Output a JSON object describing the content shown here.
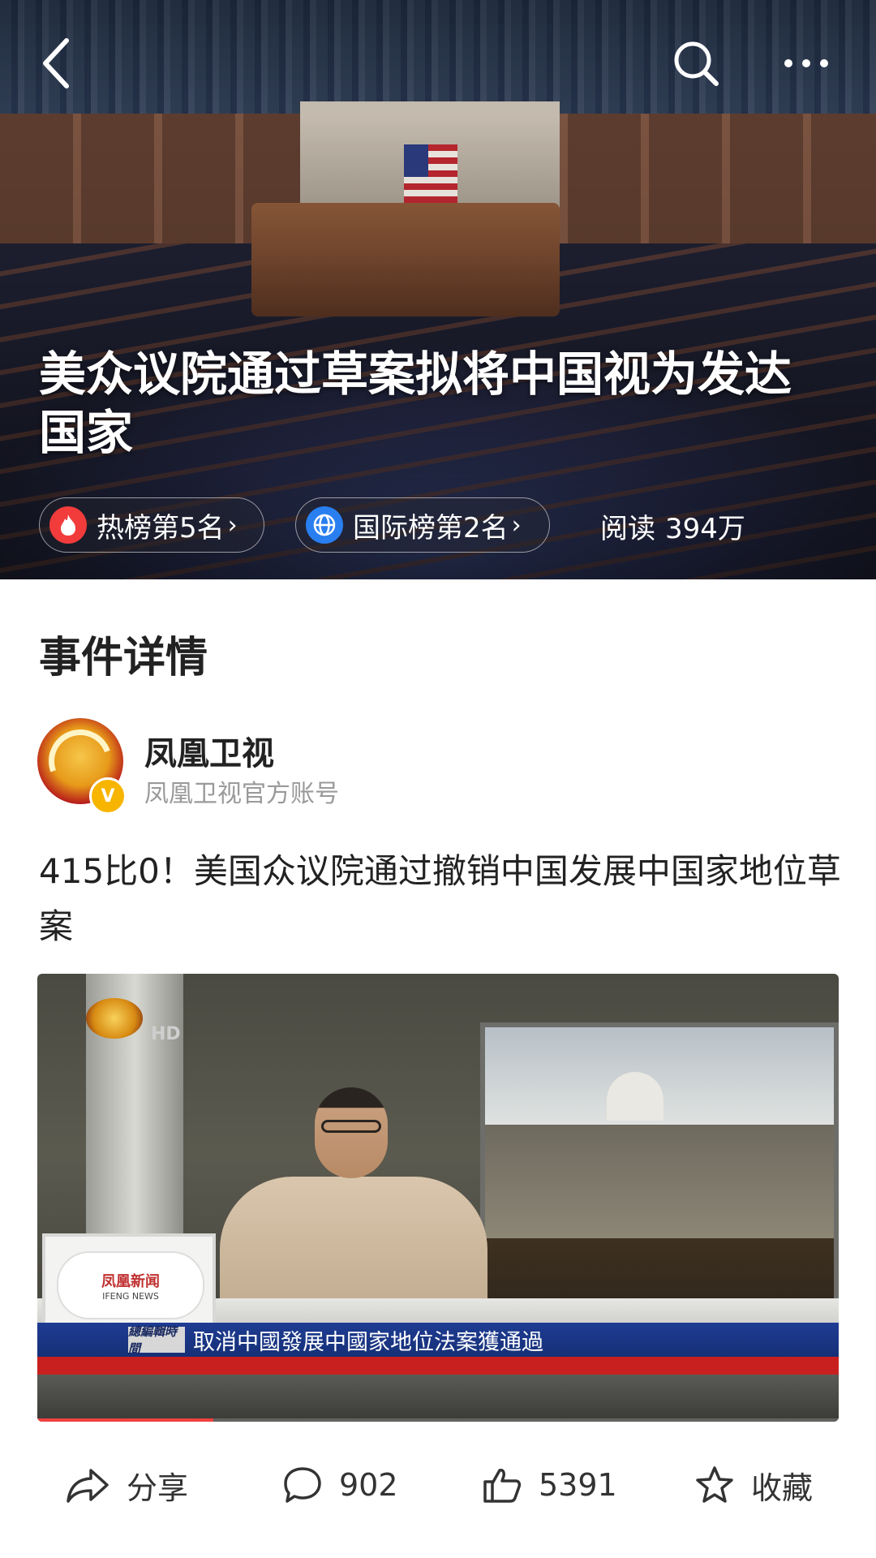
{
  "header": {
    "title": "美众议院通过草案拟将中国视为发达国家",
    "icons": {
      "back": "back-arrow-icon",
      "search": "search-icon",
      "more": "more-dots-icon"
    }
  },
  "badges": [
    {
      "label": "热榜第5名",
      "icon": "fire-icon",
      "color": "#f23c3c"
    },
    {
      "label": "国际榜第2名",
      "icon": "globe-icon",
      "color": "#2a7ff0"
    }
  ],
  "reads": {
    "label": "阅读",
    "count": "394万"
  },
  "section": {
    "title": "事件详情"
  },
  "account": {
    "name": "凤凰卫视",
    "description": "凤凰卫视官方账号"
  },
  "post": {
    "text": "415比0！美国众议院通过撤销中国发展中国家地位草案",
    "video": {
      "hd_label": "HD",
      "monitor_logo": "凤凰新闻",
      "monitor_logo_sub": "IFENG NEWS",
      "ticker_tag": "總編輯時間",
      "ticker_text": "取消中國發展中國家地位法案獲通過",
      "progress": 0.22
    }
  },
  "actions": {
    "share": {
      "label": "分享",
      "icon": "share-icon"
    },
    "comments": {
      "count": "902",
      "icon": "comment-icon"
    },
    "likes": {
      "count": "5391",
      "icon": "thumbs-up-icon"
    },
    "favorite": {
      "label": "收藏",
      "icon": "star-icon"
    }
  }
}
